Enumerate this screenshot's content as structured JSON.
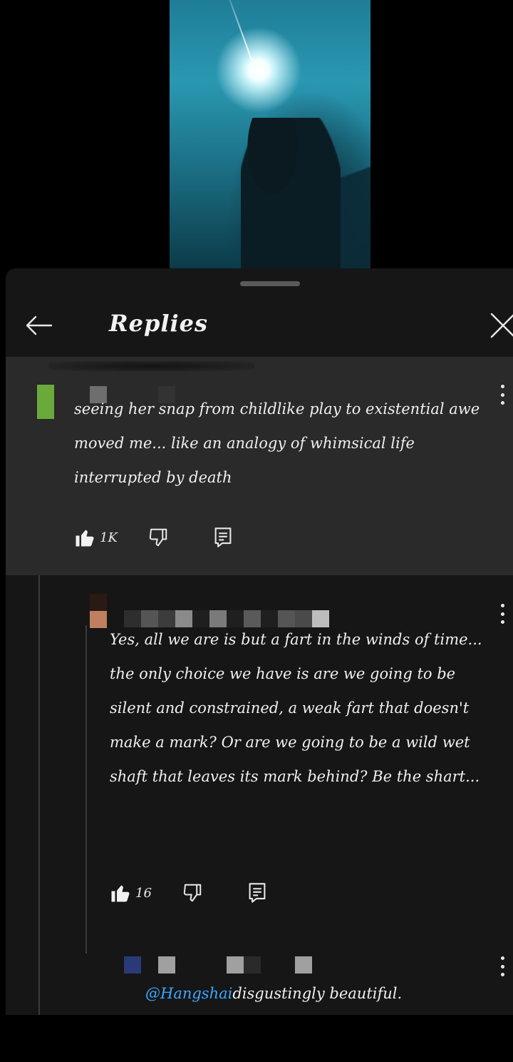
{
  "sheet": {
    "title": "Replies"
  },
  "comments": [
    {
      "text": "seeing her snap from childlike play to existential awe moved me... like an analogy of whimsical life interrupted by death",
      "likes": "1K"
    },
    {
      "text": "Yes, all we are is but a fart in the winds of time...  the only choice we have is are we going to be silent and constrained, a weak fart that doesn't make a mark? Or are we going to be a wild wet shaft that leaves its mark behind? Be the shart...",
      "likes": "16"
    },
    {
      "mention": "@Hangshai",
      "text": "disgustingly beautiful."
    }
  ],
  "icons": {
    "back": "arrow-left-icon",
    "close": "close-icon",
    "like": "thumbs-up-icon",
    "dislike": "thumbs-down-icon",
    "reply": "reply-icon",
    "more": "more-vertical-icon"
  },
  "colors": {
    "mention": "#3ea6ff",
    "background": "#161616",
    "highlight": "#2a2a2a"
  }
}
